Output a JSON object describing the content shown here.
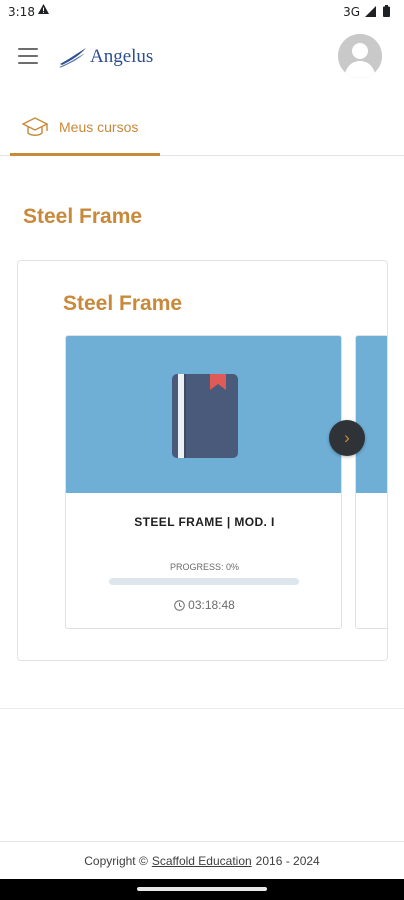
{
  "status_bar": {
    "time": "3:18",
    "warning_icon": "warning-icon",
    "network": "3G",
    "signal_icon": "signal-icon",
    "battery_icon": "battery-icon"
  },
  "header": {
    "menu_icon": "hamburger-menu-icon",
    "logo_text": "Angelus",
    "avatar_icon": "user-avatar-icon"
  },
  "tabs": [
    {
      "label": "Meus cursos",
      "icon": "graduation-cap-icon",
      "active": true
    }
  ],
  "section_title": "Steel Frame",
  "category": {
    "title": "Steel Frame",
    "courses": [
      {
        "name": "STEEL FRAME | MOD. I",
        "progress_label": "PROGRESS: 0%",
        "progress": 0,
        "duration": "03:18:48",
        "cover_icon": "book-icon",
        "duration_icon": "clock-icon"
      }
    ],
    "next_icon": "chevron-right-icon"
  },
  "footer": {
    "prefix": "Copyright ©",
    "link": "Scaffold Education",
    "suffix": "2016 - 2024"
  },
  "colors": {
    "accent": "#c8893b",
    "cover": "#6fafd6",
    "book": "#4a5a7a",
    "bookmark": "#e05a57",
    "logo": "#2c4f8f"
  }
}
